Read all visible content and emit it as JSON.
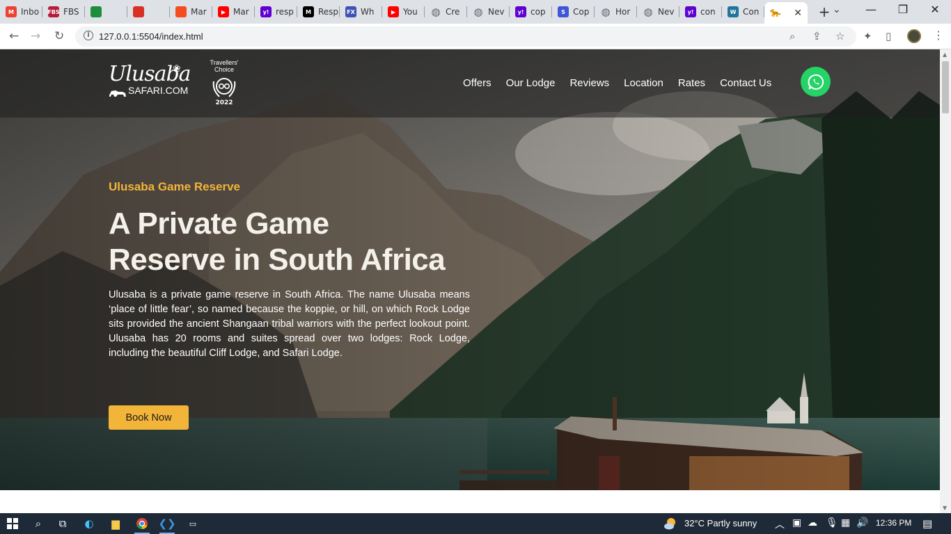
{
  "browser": {
    "tabs": [
      {
        "label": "Inbo",
        "icon": "gmail-icon",
        "color": "#ea4335",
        "glyph": "M"
      },
      {
        "label": "FBS",
        "icon": "fbs-icon",
        "color": "#b71c3b",
        "glyph": "FBS"
      },
      {
        "label": "",
        "icon": "meet-icon",
        "color": "#1e8e3e",
        "glyph": ""
      },
      {
        "label": "",
        "icon": "record-icon",
        "color": "#d93025",
        "glyph": ""
      },
      {
        "label": "Mar",
        "icon": "figma-icon",
        "color": "#f24e1e",
        "glyph": ""
      },
      {
        "label": "Mar",
        "icon": "youtube-icon",
        "color": "#ff0000",
        "glyph": "▶"
      },
      {
        "label": "resp",
        "icon": "yahoo-icon",
        "color": "#5f01d1",
        "glyph": "y!"
      },
      {
        "label": "Resp",
        "icon": "medium-icon",
        "color": "#000000",
        "glyph": "M"
      },
      {
        "label": "Wh",
        "icon": "fx-icon",
        "color": "#3f51b5",
        "glyph": "FX"
      },
      {
        "label": "You",
        "icon": "youtube-icon",
        "color": "#ff0000",
        "glyph": "▶"
      },
      {
        "label": "Cre",
        "icon": "globe-icon",
        "color": "#5f6368",
        "glyph": "◍"
      },
      {
        "label": "Nev",
        "icon": "globe-icon",
        "color": "#5f6368",
        "glyph": "◍"
      },
      {
        "label": "cop",
        "icon": "yahoo-icon",
        "color": "#5f01d1",
        "glyph": "y!"
      },
      {
        "label": "Cop",
        "icon": "s-icon",
        "color": "#4056d6",
        "glyph": "S"
      },
      {
        "label": "Hor",
        "icon": "globe-icon",
        "color": "#5f6368",
        "glyph": "◍"
      },
      {
        "label": "Nev",
        "icon": "globe-icon",
        "color": "#5f6368",
        "glyph": "◍"
      },
      {
        "label": "con",
        "icon": "yahoo-icon",
        "color": "#5f01d1",
        "glyph": "y!"
      },
      {
        "label": "Con",
        "icon": "wordpress-icon",
        "color": "#21759b",
        "glyph": "W"
      }
    ],
    "active_tab": {
      "icon": "lion-icon",
      "close": "✕"
    },
    "new_tab": "+",
    "url": "127.0.0.1:5504/index.html"
  },
  "site": {
    "logo": {
      "main": "Ulusaba",
      "sub": "SAFARI.COM"
    },
    "badge": {
      "title": "Travellers' Choice",
      "year": "2022"
    },
    "nav": [
      "Offers",
      "Our Lodge",
      "Reviews",
      "Location",
      "Rates",
      "Contact Us"
    ],
    "hero": {
      "eyebrow": "Ulusaba Game Reserve",
      "headline_1": "A Private Game",
      "headline_2": "Reserve in South Africa",
      "description": "Ulusaba is a private game reserve in South Africa. The name Ulusaba means ‘place of little fear’, so named because the koppie, or hill, on which Rock Lodge sits provided the ancient Shangaan tribal warriors with the perfect lookout point. Ulusaba has 20 rooms and suites spread over two lodges: Rock Lodge, including the beautiful Cliff Lodge, and Safari Lodge.",
      "cta": "Book Now"
    },
    "colors": {
      "accent": "#f3b43a",
      "whatsapp": "#25d366"
    }
  },
  "taskbar": {
    "weather": "32°C  Partly sunny",
    "time": "12:36 PM"
  }
}
